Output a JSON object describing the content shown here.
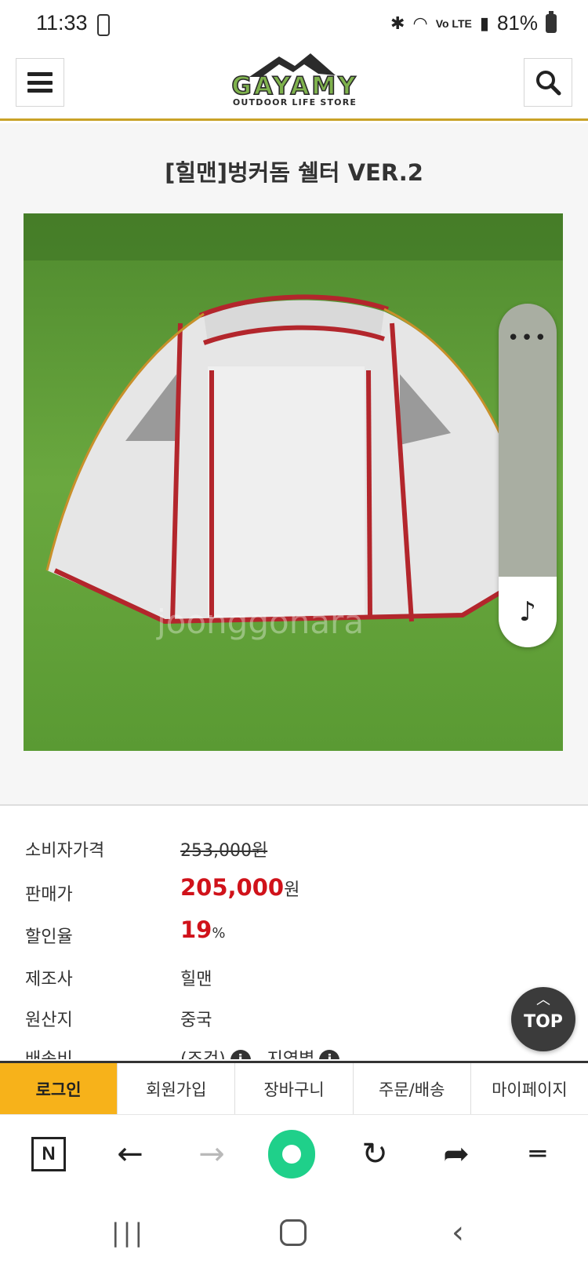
{
  "status_bar": {
    "time": "11:33",
    "battery": "81%",
    "icons": [
      "bluetooth-icon",
      "wifi-icon",
      "volte-icon",
      "signal-icon",
      "battery-icon"
    ],
    "volte_label": "Vo LTE"
  },
  "header": {
    "logo_text": "GAYAMY",
    "logo_subtext": "OUTDOOR LIFE STORE",
    "accent_color": "#c9a227"
  },
  "product": {
    "title": "[힐맨]벙커돔 쉘터 VER.2",
    "watermark": "joonggonara"
  },
  "info_rows": [
    {
      "label": "소비자가격",
      "value": "253,000원"
    },
    {
      "label": "판매가",
      "value": "205,000",
      "unit": "원"
    },
    {
      "label": "할인율",
      "value": "19",
      "unit": "%"
    },
    {
      "label": "제조사",
      "value": "힐맨"
    },
    {
      "label": "원산지",
      "value": "중국"
    },
    {
      "label": "배송비",
      "value": "(조건)",
      "value2": "지역별"
    }
  ],
  "float_panel": {
    "dots": "•••",
    "music_icon": "♪"
  },
  "top_button": {
    "label": "TOP"
  },
  "site_menu": [
    "로그인",
    "회원가입",
    "장바구니",
    "주문/배송",
    "마이페이지"
  ],
  "browser_bar": {
    "n_label": "N"
  },
  "colors": {
    "price_red": "#d0121a",
    "login_active": "#f7b21a",
    "home_green": "#1fd08a"
  }
}
